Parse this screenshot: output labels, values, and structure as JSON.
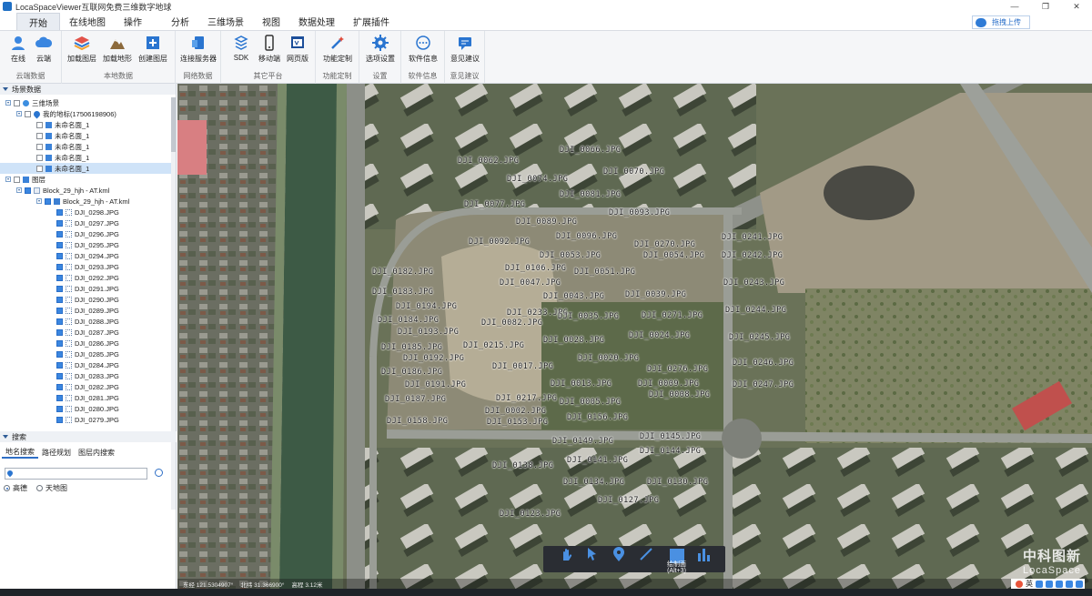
{
  "window": {
    "title": "LocaSpaceViewer互联网免费三维数字地球",
    "controls": [
      "—",
      "❐",
      "✕"
    ]
  },
  "menu": {
    "tabs": [
      "开始",
      "在线地图",
      "操作",
      "分析",
      "三维场景",
      "视图",
      "数据处理",
      "扩展插件"
    ],
    "upload": "拖拽上传"
  },
  "ribbon": {
    "groups": [
      {
        "label": "云端数据",
        "buttons": [
          "在线",
          "云端"
        ]
      },
      {
        "label": "本地数据",
        "buttons": [
          "加载图层",
          "加载地形",
          "创建图层"
        ]
      },
      {
        "label": "网络数据",
        "buttons": [
          "连接服务器"
        ]
      },
      {
        "label": "其它平台",
        "buttons": [
          "SDK",
          "移动端",
          "网页版"
        ]
      },
      {
        "label": "功能定制",
        "buttons": [
          "功能定制"
        ]
      },
      {
        "label": "设置",
        "buttons": [
          "选项设置"
        ]
      },
      {
        "label": "软件信息",
        "buttons": [
          "软件信息"
        ]
      },
      {
        "label": "意见建议",
        "buttons": [
          "意见建议"
        ]
      }
    ]
  },
  "scene_panel": {
    "title": "场景数据",
    "tree": [
      {
        "label": "三维场景",
        "icon": "globe",
        "indent": 0
      },
      {
        "label": "我的地标(17506198906)",
        "icon": "pin",
        "indent": 1
      },
      {
        "label": "未命名面_1",
        "icon": "blue",
        "indent": 2
      },
      {
        "label": "未命名面_1",
        "icon": "blue",
        "indent": 2
      },
      {
        "label": "未命名面_1",
        "icon": "blue",
        "indent": 2
      },
      {
        "label": "未命名面_1",
        "icon": "blue",
        "indent": 2
      },
      {
        "label": "未命名面_1",
        "icon": "blue",
        "indent": 2
      },
      {
        "label": "图层",
        "icon": "layers",
        "indent": 0
      },
      {
        "label": "Block_29_hjh - AT.kml",
        "icon": "file",
        "indent": 1
      },
      {
        "label": "Block_29_hjh - AT.kml",
        "icon": "folder",
        "indent": 2
      },
      {
        "label": "DJI_0298.JPG",
        "icon": "dots",
        "indent": 3
      },
      {
        "label": "DJI_0297.JPG",
        "icon": "dots",
        "indent": 3
      },
      {
        "label": "DJI_0296.JPG",
        "icon": "dots",
        "indent": 3
      },
      {
        "label": "DJI_0295.JPG",
        "icon": "dots",
        "indent": 3
      },
      {
        "label": "DJI_0294.JPG",
        "icon": "dots",
        "indent": 3
      },
      {
        "label": "DJI_0293.JPG",
        "icon": "dots",
        "indent": 3
      },
      {
        "label": "DJI_0292.JPG",
        "icon": "dots",
        "indent": 3
      },
      {
        "label": "DJI_0291.JPG",
        "icon": "dots",
        "indent": 3
      },
      {
        "label": "DJI_0290.JPG",
        "icon": "dots",
        "indent": 3
      },
      {
        "label": "DJI_0289.JPG",
        "icon": "dots",
        "indent": 3
      },
      {
        "label": "DJI_0288.JPG",
        "icon": "dots",
        "indent": 3
      },
      {
        "label": "DJI_0287.JPG",
        "icon": "dots",
        "indent": 3
      },
      {
        "label": "DJI_0286.JPG",
        "icon": "dots",
        "indent": 3
      },
      {
        "label": "DJI_0285.JPG",
        "icon": "dots",
        "indent": 3
      },
      {
        "label": "DJI_0284.JPG",
        "icon": "dots",
        "indent": 3
      },
      {
        "label": "DJI_0283.JPG",
        "icon": "dots",
        "indent": 3
      },
      {
        "label": "DJI_0282.JPG",
        "icon": "dots",
        "indent": 3
      },
      {
        "label": "DJI_0281.JPG",
        "icon": "dots",
        "indent": 3
      },
      {
        "label": "DJI_0280.JPG",
        "icon": "dots",
        "indent": 3
      },
      {
        "label": "DJI_0279.JPG",
        "icon": "dots",
        "indent": 3
      }
    ]
  },
  "search_panel": {
    "title": "搜索",
    "tabs": [
      "地名搜索",
      "路径规划",
      "图层内搜索"
    ],
    "input_value": "",
    "options": [
      "高德",
      "天地图"
    ],
    "selected_option": "高德"
  },
  "map": {
    "photo_labels": [
      "DJI_0066.JPG",
      "DJI_0062.JPG",
      "DJI_0070.JPG",
      "DJI_0074.JPG",
      "DJI_0081.JPG",
      "DJI_0077.JPG",
      "DJI_0093.JPG",
      "DJI_0089.JPG",
      "DJI_0092.JPG",
      "DJI_0096.JPG",
      "DJI_0270.JPG",
      "DJI_0241.JPG",
      "DJI_0053.JPG",
      "DJI_0054.JPG",
      "DJI_0242.JPG",
      "DJI_0182.JPG",
      "DJI_0106.JPG",
      "DJI_0051.JPG",
      "DJI_0183.JPG",
      "DJI_0047.JPG",
      "DJI_0243.JPG",
      "DJI_0043.JPG",
      "DJI_0039.JPG",
      "DJI_0194.JPG",
      "DJI_0233.JPG",
      "DJI_0184.JPG",
      "DJI_0035.JPG",
      "DJI_0271.JPG",
      "DJI_0244.JPG",
      "DJI_0082.JPG",
      "DJI_0193.JPG",
      "DJI_0024.JPG",
      "DJI_0185.JPG",
      "DJI_0215.JPG",
      "DJI_0028.JPG",
      "DJI_0245.JPG",
      "DJI_0192.JPG",
      "DJI_0020.JPG",
      "DJI_0017.JPG",
      "DJI_0276.JPG",
      "DJI_0246.JPG",
      "DJI_0186.JPG",
      "DJI_0013.JPG",
      "DJI_0191.JPG",
      "DJI_0009.JPG",
      "DJI_0247.JPG",
      "DJI_0008.JPG",
      "DJI_0187.JPG",
      "DJI_0217.JPG",
      "DJI_0005.JPG",
      "DJI_0002.JPG",
      "DJI_0156.JPG",
      "DJI_0158.JPG",
      "DJI_0153.JPG",
      "DJI_0145.JPG",
      "DJI_0149.JPG",
      "DJI_0144.JPG",
      "DJI_0141.JPG",
      "DJI_0138.JPG",
      "DJI_0134.JPG",
      "DJI_0130.JPG",
      "DJI_0127.JPG",
      "DJI_0123.JPG"
    ],
    "tools": [
      "hand-icon",
      "pointer-icon",
      "marker-icon",
      "line-icon",
      "polygon-icon",
      "chart-icon"
    ],
    "draw_tool_label": "绘制面",
    "draw_tool_shortcut": "(Alt+3)",
    "brand_cn": "中科图新",
    "brand_en": "LocaSpace"
  },
  "status": {
    "longitude": "东经 121.5304907°",
    "latitude": "北纬 31.366900°",
    "altitude": "高程 3.12米"
  },
  "tray": {
    "ime": "英"
  },
  "colors": {
    "accent": "#2f6fc6",
    "map_green": "#5d6a4a",
    "river": "#36523f"
  }
}
